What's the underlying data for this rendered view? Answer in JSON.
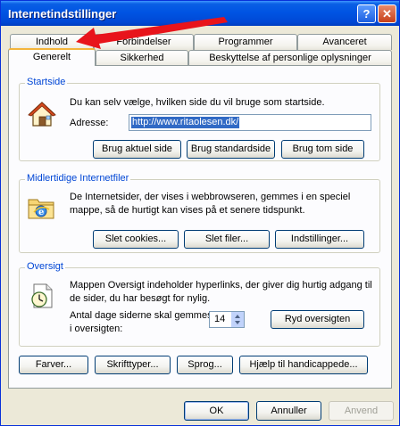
{
  "window": {
    "title": "Internetindstillinger",
    "help_glyph": "?",
    "close_glyph": "✕"
  },
  "tabs_back": [
    {
      "label": "Indhold"
    },
    {
      "label": "Forbindelser"
    },
    {
      "label": "Programmer"
    },
    {
      "label": "Avanceret"
    }
  ],
  "tabs_front": [
    {
      "label": "Generelt"
    },
    {
      "label": "Sikkerhed"
    },
    {
      "label": "Beskyttelse af personlige oplysninger"
    }
  ],
  "startside": {
    "title": "Startside",
    "description": "Du kan selv vælge, hvilken side du vil bruge som startside.",
    "address_label": "Adresse:",
    "address_value": "http://www.ritaolesen.dk/",
    "buttons": [
      "Brug aktuel side",
      "Brug standardside",
      "Brug tom side"
    ]
  },
  "temp_files": {
    "title": "Midlertidige Internetfiler",
    "description": "De Internetsider, der vises i webbrowseren, gemmes i en speciel mappe, så de hurtigt kan vises på et senere tidspunkt.",
    "buttons": [
      "Slet cookies...",
      "Slet filer...",
      "Indstillinger..."
    ]
  },
  "history": {
    "title": "Oversigt",
    "description": "Mappen Oversigt indeholder hyperlinks, der giver dig hurtig adgang til de sider, du har besøgt for nylig.",
    "days_label": "Antal dage siderne skal gemmes i oversigten:",
    "days_value": "14",
    "clear_button": "Ryd oversigten"
  },
  "bottom_buttons": [
    "Farver...",
    "Skrifttyper...",
    "Sprog...",
    "Hjælp til handicappede..."
  ],
  "dialog_buttons": {
    "ok": "OK",
    "cancel": "Annuller",
    "apply": "Anvend"
  },
  "colors": {
    "title_bar": "#0054e3",
    "group_title": "#0046d5",
    "annotation_arrow": "#e8141b"
  }
}
